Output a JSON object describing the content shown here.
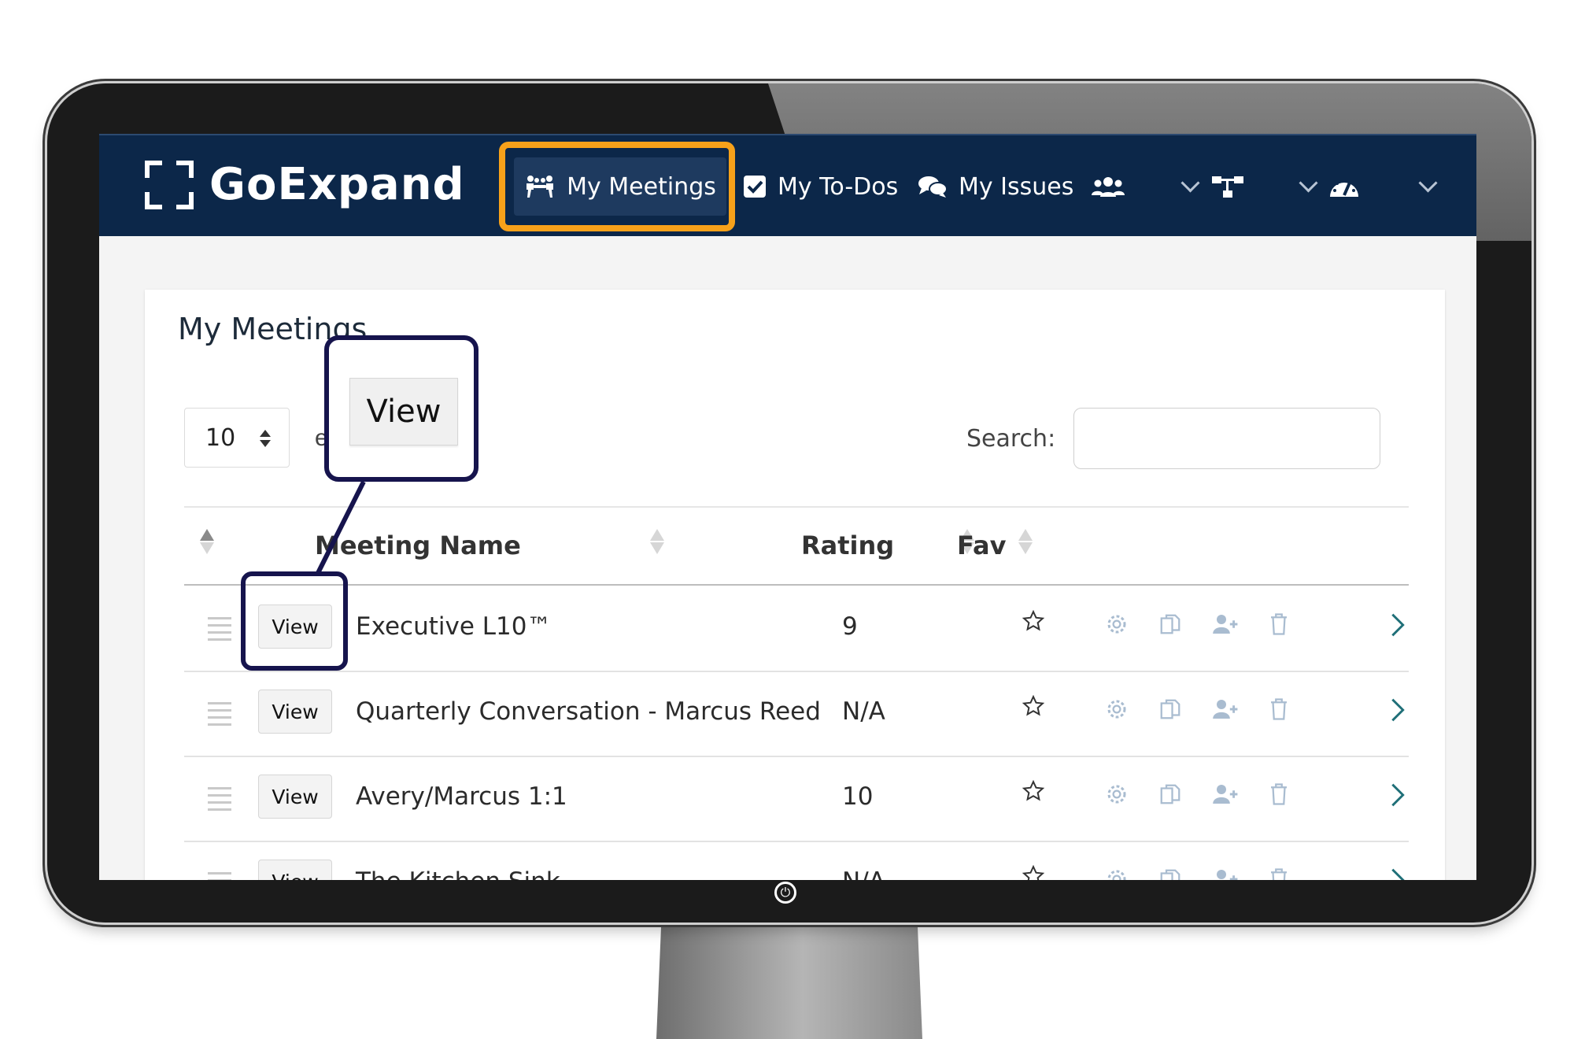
{
  "app": {
    "logo_text": "GoExpand"
  },
  "nav": {
    "my_meetings": "My Meetings",
    "my_todos": "My To-Dos",
    "my_issues": "My Issues",
    "icons": [
      "users-icon",
      "org-chart-icon",
      "dashboard-icon"
    ]
  },
  "page": {
    "title": "My Meetings",
    "page_length": "10",
    "length_suffix": "e",
    "search_label": "Search:",
    "search_value": ""
  },
  "table": {
    "columns": {
      "name": "Meeting Name",
      "rating": "Rating",
      "fav": "Fav"
    },
    "rows": [
      {
        "view": "View",
        "name": "Executive L10™",
        "rating": "9"
      },
      {
        "view": "View",
        "name": "Quarterly Conversation - Marcus Reed",
        "rating": "N/A"
      },
      {
        "view": "View",
        "name": "Avery/Marcus 1:1",
        "rating": "10"
      },
      {
        "view": "View",
        "name": "The Kitchen Sink",
        "rating": "N/A"
      }
    ]
  },
  "callout": {
    "label": "View"
  },
  "colors": {
    "navbar": "#0c2749",
    "highlight": "#f7a11a",
    "callout": "#16144d",
    "accent": "#1f6f78"
  }
}
